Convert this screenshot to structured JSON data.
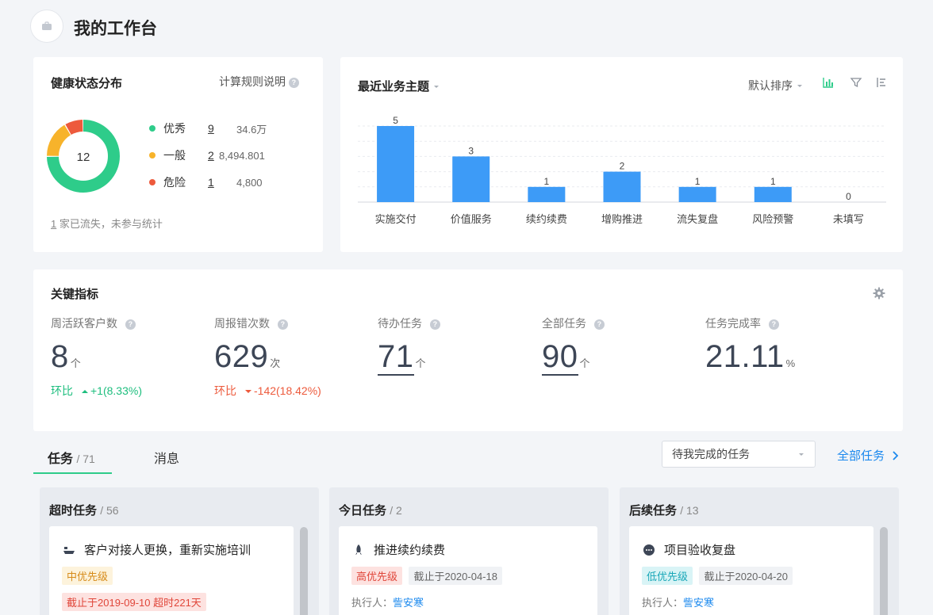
{
  "header": {
    "title": "我的工作台",
    "icon": "briefcase-icon"
  },
  "health": {
    "title": "健康状态分布",
    "rule_link": "计算规则说明",
    "total": "12",
    "legend": [
      {
        "label": "优秀",
        "count": "9",
        "amount": "34.6万",
        "color": "#2ecc8a"
      },
      {
        "label": "一般",
        "count": "2",
        "amount": "8,494.801",
        "color": "#f7b32b"
      },
      {
        "label": "危险",
        "count": "1",
        "amount": "4,800",
        "color": "#ed5a3c"
      }
    ],
    "churn_count": "1",
    "churn_text": "家已流失，未参与统计"
  },
  "topics": {
    "title": "最近业务主题",
    "sort_label": "默认排序",
    "chart_data": {
      "type": "bar",
      "categories": [
        "实施交付",
        "价值服务",
        "续约续费",
        "增购推进",
        "流失复盘",
        "风险预警",
        "未填写"
      ],
      "values": [
        5,
        3,
        1,
        2,
        1,
        1,
        0
      ],
      "ylim": [
        0,
        5
      ],
      "color": "#3d9bf7",
      "grid": true
    }
  },
  "metrics": {
    "title": "关键指标",
    "items": [
      {
        "label": "周活跃客户数",
        "value": "8",
        "unit": "个",
        "change_label": "环比",
        "change": "+1(8.33%)",
        "direction": "up"
      },
      {
        "label": "周报错次数",
        "value": "629",
        "unit": "次",
        "change_label": "环比",
        "change": "-142(18.42%)",
        "direction": "down"
      },
      {
        "label": "待办任务",
        "value": "71",
        "unit": "个"
      },
      {
        "label": "全部任务",
        "value": "90",
        "unit": "个"
      },
      {
        "label": "任务完成率",
        "value": "21.11",
        "unit": "%"
      }
    ]
  },
  "tabs": [
    {
      "label": "任务",
      "count": "/ 71"
    },
    {
      "label": "消息"
    }
  ],
  "filter": {
    "selected": "待我完成的任务"
  },
  "all_tasks_label": "全部任务",
  "columns": [
    {
      "title": "超时任务",
      "count": "/ 56",
      "task": {
        "icon": "ship-icon",
        "title": "客户对接人更换，重新实施培训",
        "priority": "中优先级",
        "overdue": "截止于2019-09-10 超时221天"
      }
    },
    {
      "title": "今日任务",
      "count": "/ 2",
      "task": {
        "icon": "rocket-icon",
        "title": "推进续约续费",
        "priority": "高优先级",
        "due": "截止于2020-04-18",
        "assignee_label": "执行人：",
        "assignee": "訾安寒"
      }
    },
    {
      "title": "后续任务",
      "count": "/ 13",
      "task": {
        "icon": "chat-icon",
        "title": "项目验收复盘",
        "priority": "低优先级",
        "due": "截止于2020-04-20",
        "assignee_label": "执行人：",
        "assignee": "訾安寒"
      }
    }
  ]
}
